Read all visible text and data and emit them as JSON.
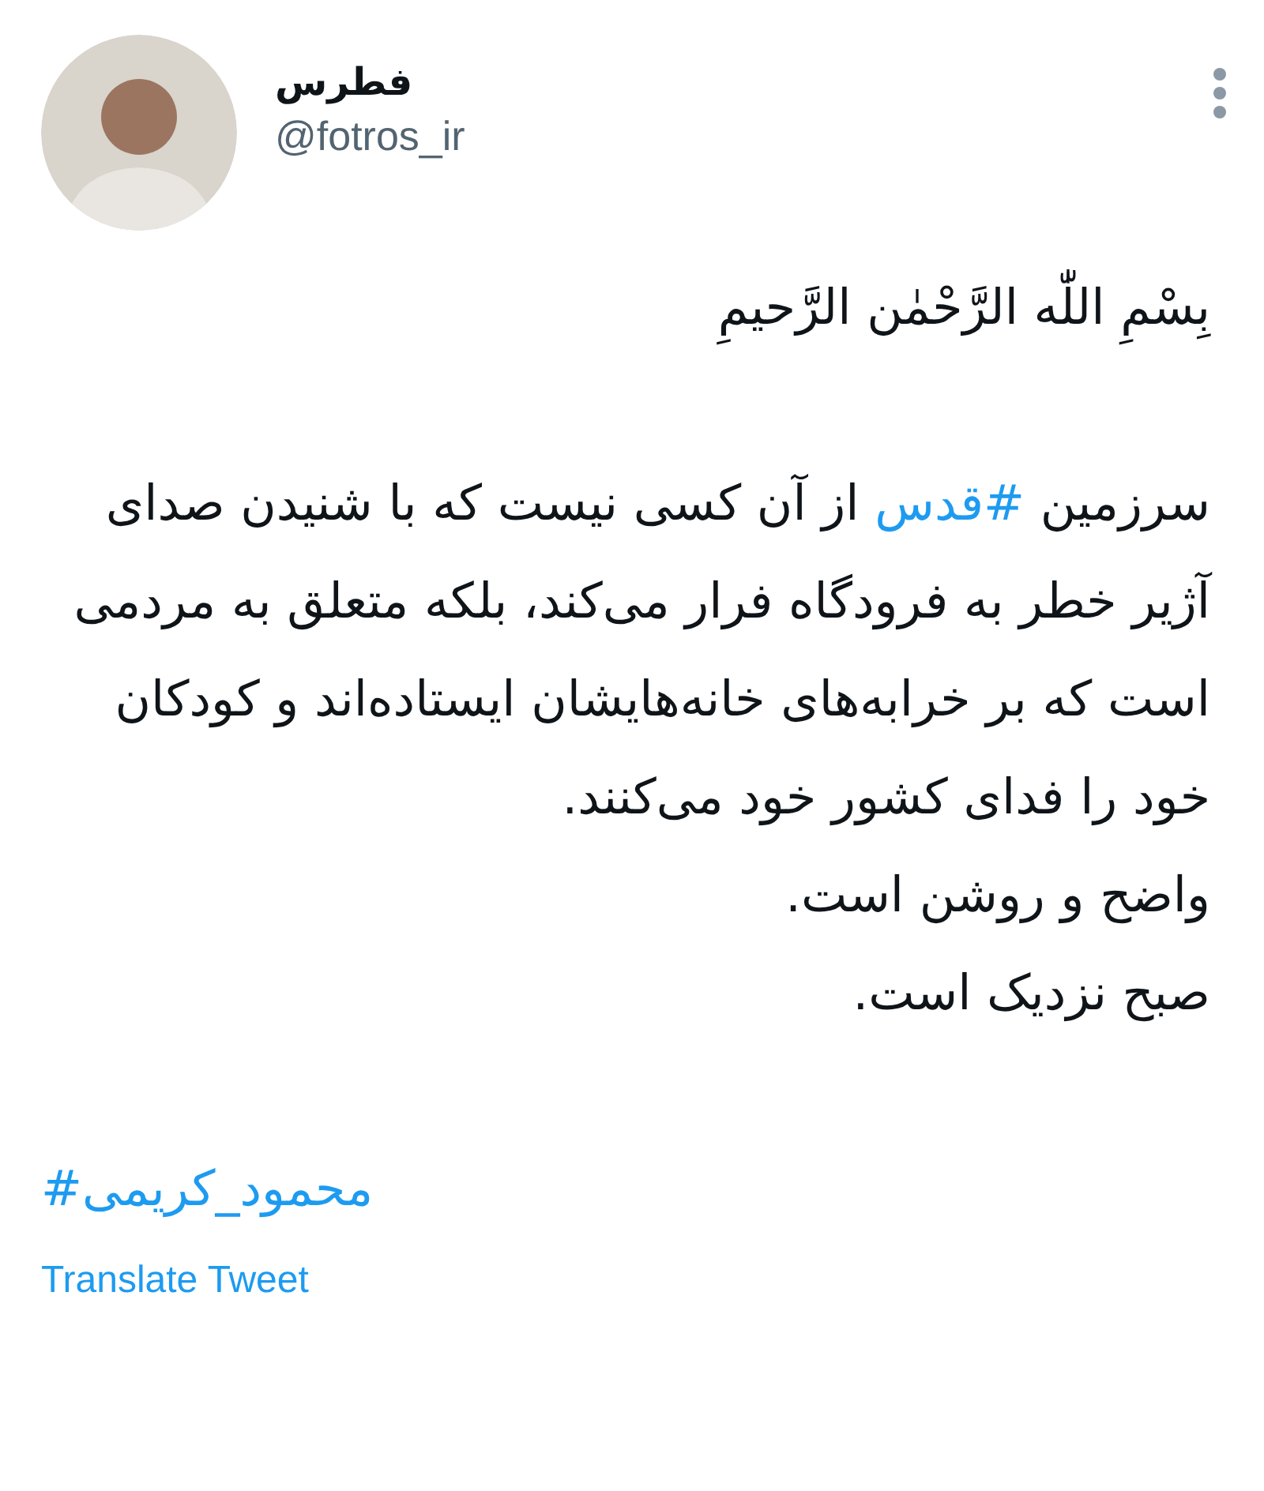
{
  "author": {
    "name": "فطرس",
    "handle": "@fotros_ir"
  },
  "body": [
    {
      "segments": [
        {
          "kind": "text",
          "text": "بِسْمِ اللّٰه الرَّحْمٰن الرَّحیمِ"
        }
      ]
    },
    {
      "segments": [
        {
          "kind": "text",
          "text": "سرزمین "
        },
        {
          "kind": "hashtag",
          "text": "#قدس"
        },
        {
          "kind": "text",
          "text": " از آن کسی نیست که با شنیدن صدای آژیر خطر به فرودگاه فرار می‌کند، بلکه متعلق به مردمی است که بر خرابه‌های خانه‌هایشان ایستاده‌اند و کودکان خود را فدای کشور خود می‌کنند."
        }
      ]
    },
    {
      "segments": [
        {
          "kind": "text",
          "text": "واضح و روشن است."
        }
      ]
    },
    {
      "segments": [
        {
          "kind": "text",
          "text": "صبح نزدیک است."
        }
      ]
    }
  ],
  "hashtag": "#محمود_کریمی",
  "translate_link": "Translate Tweet"
}
